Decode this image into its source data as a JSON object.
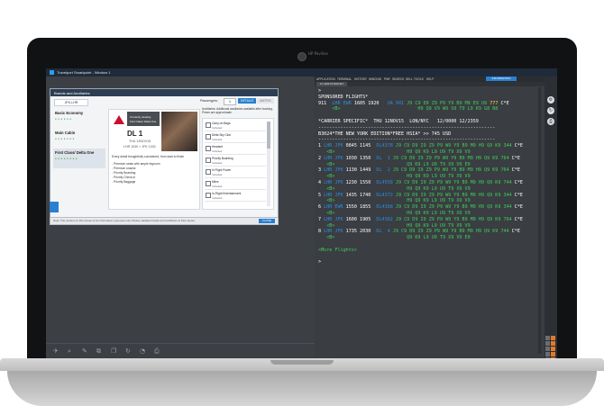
{
  "device": {
    "brand": "HP Pavilion"
  },
  "window": {
    "title": "Travelport Smartpoint - Window 1"
  },
  "brands_panel": {
    "header": "Brands and Ancillaries",
    "route_tab": "JFK-LHR",
    "passengers_label": "Passengers:",
    "passengers_value": "1",
    "details_button": "DETAILS",
    "matrix_button": "MATRIX",
    "brands": [
      {
        "name": "Basic Economy"
      },
      {
        "name": "Main Cabin"
      },
      {
        "name": "First Class/ Delta One",
        "selected": true
      }
    ],
    "card": {
      "viewing_line1": "Currently viewing:",
      "viewing_line2": "First Class/ Delta One",
      "flight_number": "DL 1",
      "flight_date": "THU 12NOV15",
      "flight_time": "LHR 1030 > JFK 1330",
      "description": [
        "Every detail thoughtfully considered, from start to finish",
        "",
        "- Premium seats with ample legroom",
        "- Premium snacks",
        "- Priority Boarding",
        "- Priority Check-in",
        "- Priority Baggage"
      ]
    },
    "ancillary_note": "Ancillaries: Additional ancillaries available after booking. Prices are approximate.",
    "ancillaries": [
      {
        "title": "Carry-on Bags",
        "status": "Included"
      },
      {
        "title": "Delta Sky Club",
        "status": "Included"
      },
      {
        "title": "Headset",
        "status": "Included"
      },
      {
        "title": "Priority Boarding",
        "status": "Included"
      },
      {
        "title": "In Flight Power",
        "status": "Included"
      },
      {
        "title": "Miles",
        "status": "Included"
      },
      {
        "title": "In-Flight Entertainment",
        "status": "Included"
      }
    ],
    "footer_note": "Note: The content on this screen is for information purposes only. Please validate brands and ancillaries at Fare Quote.",
    "close_button": "CLOSE"
  },
  "terminal": {
    "menu": [
      "APPLICATION",
      "TERMINAL",
      "HISTORY",
      "WINDOW",
      "PNR",
      "SEARCH",
      "SELL",
      "TOOLS",
      "HELP"
    ],
    "badge": "INFORMATION",
    "tab": "1G 2ERASTERNET",
    "lines": [
      {
        "t": ">",
        "c": "w"
      },
      {
        "t": "SPONSORED FLIGHTS*",
        "c": "w"
      },
      {
        "t": "911  LHR EWR 1605 1920   UA 901 J9 C9 D9 Z9 P9 Y9 B9 M9 E9 U9 777 C*E",
        "c": "mix1"
      },
      {
        "t": "     <B>                            H9 Q9 V9 W9 S9 T9 L9 K9 G8 N8",
        "c": "mix2"
      },
      {
        "t": "",
        "c": "w"
      },
      {
        "t": "*CARRIER SPECIFIC*  THU 12NOV15  LON/NYC   12/0000 12/2359",
        "c": "w"
      },
      {
        "t": "----------------------------------------------------------------",
        "c": "w"
      },
      {
        "t": "B3024*THE NEW YORK EDITION*FREE HSIA* >> 745 USD",
        "c": "mix3"
      },
      {
        "t": "----------------------------------------------------------------",
        "c": "w"
      }
    ],
    "flights": [
      {
        "n": "1",
        "route": "LHR JFK",
        "dep": "0845",
        "arr": "1145",
        "flt": "DL4378",
        "a": "J9 C9 D9 I9 Z9 P9 W9 Y9 B9 M9 H9 Q9 K9 344",
        "b": "H9 Q9 K9 L9 U9 T9 X9 V9"
      },
      {
        "n": "2",
        "route": "LHR JFK",
        "dep": "1030",
        "arr": "1350",
        "flt": "DL  1",
        "a": "J9 C9 D9 I9 Z9 P9 W9 Y9 B9 M9 H9 Q9 K9 764",
        "b": "Q9 K9 L9 U9 T9 X9 V9 E0"
      },
      {
        "n": "3",
        "route": "LHR JFK",
        "dep": "1130",
        "arr": "1449",
        "flt": "DL  2",
        "a": "J9 C9 D9 I9 Z9 P9 W9 Y9 B9 M9 H9 Q9 K9 764",
        "b": "H9 Q9 K9 L9 U9 T9 X9 V9"
      },
      {
        "n": "4",
        "route": "LHR JFK",
        "dep": "1230",
        "arr": "1550",
        "flt": "DL4558",
        "a": "J9 C9 D9 I9 Z9 P9 W9 Y9 B9 M9 H9 Q9 K9 744",
        "b": "H9 Q9 K9 L9 U9 T9 X9 V9"
      },
      {
        "n": "5",
        "route": "LHR JFK",
        "dep": "1435",
        "arr": "1740",
        "flt": "DL4372",
        "a": "J9 C9 D9 I9 Z9 P9 W9 Y9 B9 M9 H9 Q9 K9 344",
        "b": "H9 Q9 K9 L9 U9 T9 X9 V9"
      },
      {
        "n": "6",
        "route": "LHR EWR",
        "dep": "1550",
        "arr": "1855",
        "flt": "DL4368",
        "a": "J9 C9 D9 I9 Z9 P9 W9 Y9 B9 M9 H9 Q9 K9 344",
        "b": "H9 Q9 K9 L9 U9 T9 X9 V9"
      },
      {
        "n": "7",
        "route": "LHR JFK",
        "dep": "1600",
        "arr": "1905",
        "flt": "DL4382",
        "a": "J9 C9 D9 I9 Z9 P9 W9 Y9 B9 M9 H9 Q9 K9 764",
        "b": "H9 Q9 K9 L9 U9 T9 X9 V9"
      },
      {
        "n": "8",
        "route": "LHR JFK",
        "dep": "1735",
        "arr": "2030",
        "flt": "DL  4",
        "a": "J9 C9 D9 I9 Z9 P9 W9 Y9 B9 M9 H9 Q9 K9 744",
        "b": "Q9 K9 L9 U9 T9 X9 V9 E0"
      }
    ],
    "more": "<More Flights>",
    "prompt": ">"
  },
  "colors": {
    "green": "#3fcf5a",
    "blue": "#2a8ee0",
    "yellow": "#ffd43b",
    "accent": "#2a7fd0"
  }
}
